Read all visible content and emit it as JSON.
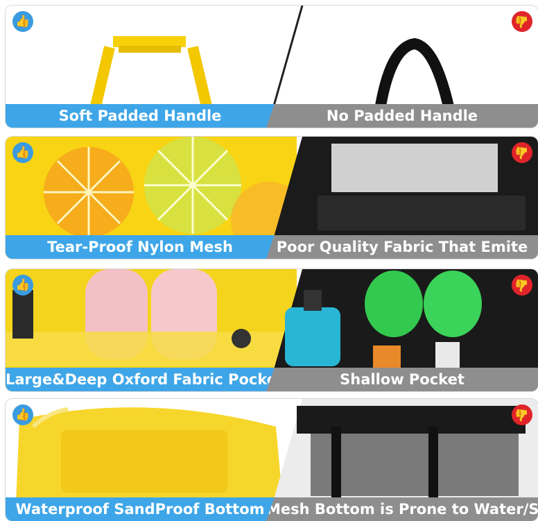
{
  "rows": [
    {
      "good_label": "Soft Padded Handle",
      "bad_label": "No Padded Handle"
    },
    {
      "good_label": "Tear-Proof Nylon Mesh",
      "bad_label": "Poor Quality Fabric That Emite"
    },
    {
      "good_label": "Large&Deep Oxford Fabric Pocket",
      "bad_label": "Shallow Pocket"
    },
    {
      "good_label": "Waterproof SandProof Bottom",
      "bad_label": "Mesh Bottom is Prone to Water/Sand"
    }
  ],
  "colors": {
    "good": "#3ea6e8",
    "bad": "#8e8e8e",
    "thumb_up": "#3a9be0",
    "thumb_down": "#e0242a",
    "yellow": "#f5d20c"
  },
  "icons": {
    "good": "thumbs-up-icon",
    "bad": "thumbs-down-icon"
  }
}
